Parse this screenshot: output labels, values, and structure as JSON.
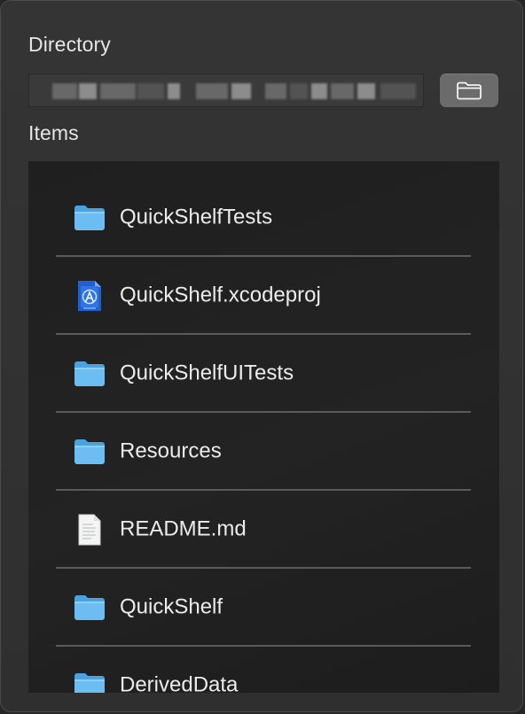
{
  "directory": {
    "label": "Directory",
    "browse_icon": "folder-icon"
  },
  "items": {
    "label": "Items",
    "list": [
      {
        "name": "QuickShelfTests",
        "icon": "folder-icon"
      },
      {
        "name": "QuickShelf.xcodeproj",
        "icon": "xcode-project-icon"
      },
      {
        "name": "QuickShelfUITests",
        "icon": "folder-icon"
      },
      {
        "name": "Resources",
        "icon": "folder-icon"
      },
      {
        "name": "README.md",
        "icon": "document-icon"
      },
      {
        "name": "QuickShelf",
        "icon": "folder-icon"
      },
      {
        "name": "DerivedData",
        "icon": "folder-icon"
      }
    ]
  },
  "colors": {
    "folder_blue": "#5fb6ef",
    "background": "#2f2f2f",
    "list_background": "#202020",
    "text": "#ececec"
  }
}
